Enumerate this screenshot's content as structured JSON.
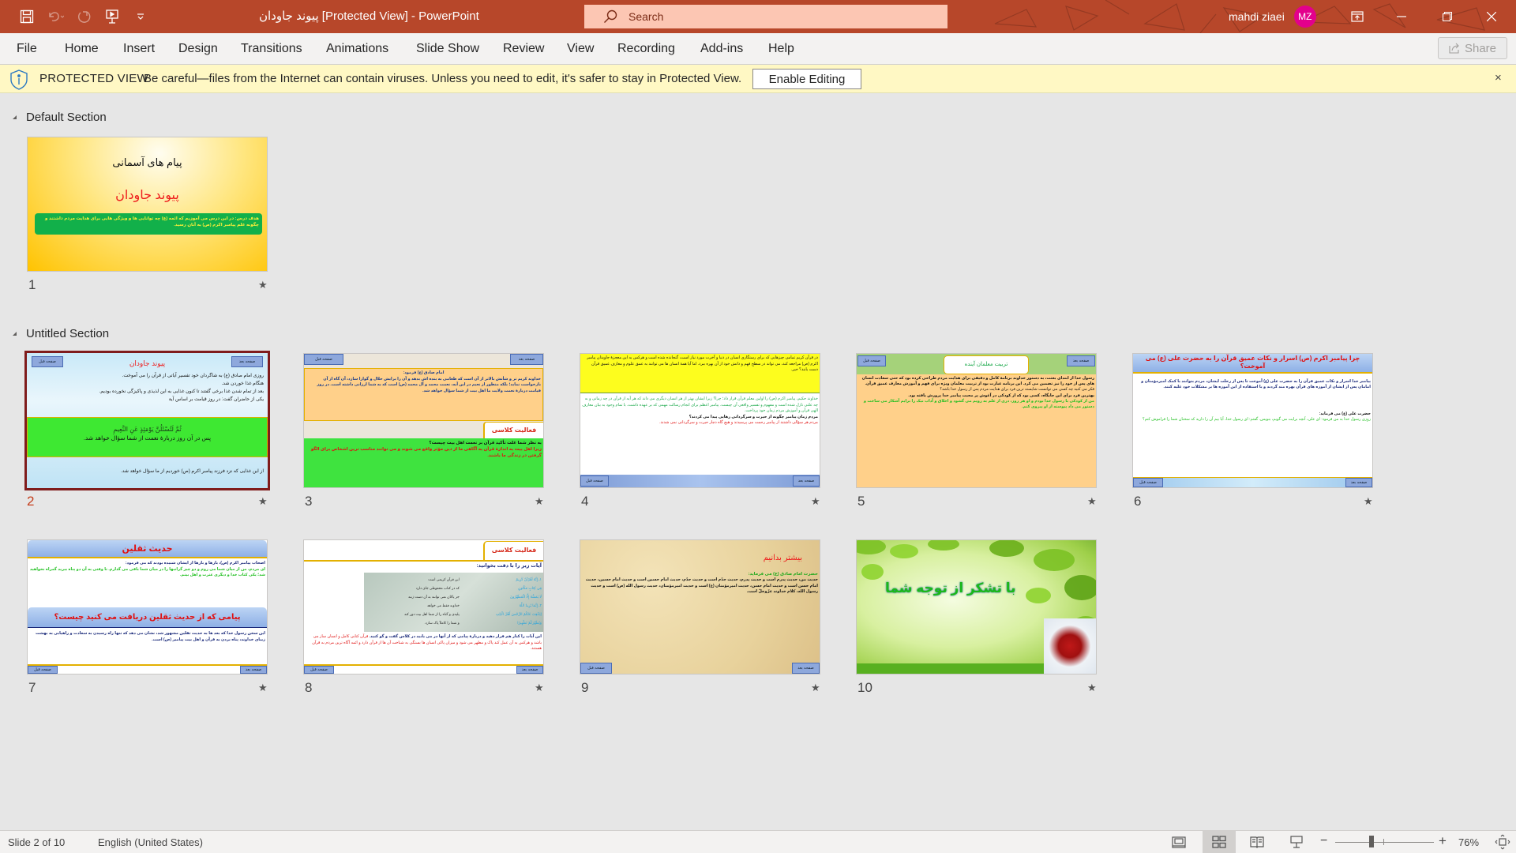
{
  "titlebar": {
    "doc_title": "پیوند جاودان [Protected View]  -  PowerPoint",
    "search_placeholder": "Search",
    "user_name": "mahdi ziaei",
    "user_initials": "MZ",
    "qat_icons": [
      "save-icon",
      "undo-icon",
      "redo-icon",
      "start-slideshow-icon",
      "customize-qat-icon"
    ],
    "window_controls": [
      "ribbon-display-options-icon",
      "minimize-icon",
      "restore-icon",
      "close-icon"
    ]
  },
  "ribbon": {
    "tabs": [
      "File",
      "Home",
      "Insert",
      "Design",
      "Transitions",
      "Animations",
      "Slide Show",
      "Review",
      "View",
      "Recording",
      "Add-ins",
      "Help"
    ],
    "share_label": "Share"
  },
  "protected_view": {
    "label": "PROTECTED VIEW",
    "message": "Be careful—files from the Internet can contain viruses. Unless you need to edit, it's safer to stay in Protected View.",
    "button": "Enable Editing",
    "close": "×"
  },
  "sections": [
    {
      "name": "Default Section"
    },
    {
      "name": "Untitled Section"
    }
  ],
  "slides": [
    {
      "number": "1",
      "title": "پیام های آسمانی",
      "subtitle": "پیوند جاودان",
      "box_text": "هدف درس: در این درس می آموزیم که ائمه (ع) چه توانایی ها و ویژگی هایی برای هدایت مردم داشتند و چگونه علم پیامبر اکرم (ص) به آنان رسید."
    },
    {
      "number": "2",
      "title": "پیوند جاودان",
      "prev": "صفحه قبل",
      "next": "صفحه بعد",
      "lines": [
        "روزی امام صادق (ع) به شاگردان خود تفسیر آیاتی از قرآن را می آموخت.",
        "هنگام غذا خوردن شد.",
        "بعد از تمام شدن غذا برخی گفتند تا کنون غذایی به این لذیذی و پاکیزگی نخورده بودیم.",
        "یکی از حاضران گفت: در روز قیامت بر اساس آیة"
      ],
      "verse": "ثُمَّ لَتُسْئَلُنَّ يَوْمَئِذٍ عَنِ النَّعِيمِ",
      "verse_tr": "پس در آن روز دربارهٔ نعمت از شما سؤال خواهد شد.",
      "footer": "از این غذایی که نزد فرزند پیامبر اکرم (ص) خوردیم از ما سؤال خواهد شد."
    },
    {
      "number": "3",
      "prev": "صفحه قبل",
      "next": "صفحه بعد",
      "quote_head": "امام صادق (ع) فرمود:",
      "quote": "خداوند کریم تر و شأنش بالاتر از آن است که طعامی به بنده اش بدهد و آن را برایش حلال و گوارا سازد، آن گاه از آن بازخواست نماید؛ بلکه منظور از نعیم در این آیه، نعمت محمد و آل محمد (ص) است که به شما ارزانی داشته است. در روز قیامت دربارهٔ نعمت ولایت ما اهل بیت از شما سؤال خواهد شد.",
      "activity": "فعالیت کلاسی",
      "question": "به نظر شما علت تأکید قرآن بر نعمت اهل بیت چیست؟",
      "answer": "زیرا اهل بیت به اندازهٔ قرآن به آگاهی ما از دین مؤثر واقع می شوند و می توانند مناسب ترین اشخاص برای الگو گرفتن در زندگی ما باشند."
    },
    {
      "number": "4",
      "prev": "صفحه قبل",
      "next": "صفحه بعد",
      "top": "در قرآن کریم تمامی چیزهایی که برای رستگاری انسان در دنیا و آخرت مورد نیاز است، گنجانده شده است و هرکس به این معجزهٔ جاویدان پیامبر اکرم (ص) مراجعه کند، می تواند در سطح فهم و دانش خود از آن بهره ببرد. اما آیا همهٔ انسان ها می توانند به عمق علوم و معارف عمیق قرآن دست یابند؟ خیر.",
      "body": "خداوند حکیم، پیامبر اکرم (ص) را اولین معلم قرآن قرار داد؛ چرا؟ زیرا ایشان بهتر از هر انسان دیگری می داند که هر آیه از قرآن در چه زمانی و به چه علتی نازل شده است و مفهوم و تفسیر واقعی آن چیست. پیامبر اعظم برای انجام رسالت مهمی که بر عهده داشت، با تمام وجود به بیان معارف الهی قرآن و آموزش مردم زمان خود پرداخت.",
      "q": "مردم زمان پیامبر چگونه از حیرت و سرگردانی رهایی پیدا می کردند؟",
      "a": "مردم هر سؤالی داشتند از پیامبر رحمت می پرسیدند و هیچ گاه دچار حیرت و سرگردانی نمی شدند."
    },
    {
      "number": "5",
      "prev": "صفحه قبل",
      "next": "صفحه بعد",
      "title": "تربیت معلمان آینده",
      "body": "رسول خدا از ابتدای بعثت، به دستور خداوند برنامهٔ کامل و دقیقی برای هدایت مردم طراحی کرده بود که حتی سعادت انسان های پس از خود را نیز تضمین می کرد. این برنامه عبارت بود از تربیت معلمان ویژه برای فهم و آموزش معارف عمیق قرآن.",
      "q": "فکر می کنید چه کسی می توانست شایسته ترین فرد برای هدایت مردم پس از رسول خدا باشد؟",
      "a": "بهترین فرد برای این جایگاه، کسی بود که از کودکی در آغوش پر محبت پیامبر خدا پرورش یافته بود.",
      "quote": "من از کودکی با رسول خدا بودم و او هر روز، دری از علم به رویم می گشود و اخلاق و آداب نیک را برایم آشکار می ساخت و دستور می داد پیوسته از او پیروی کنم."
    },
    {
      "number": "6",
      "prev": "صفحه قبل",
      "next": "صفحه بعد",
      "title": "چرا پیامبر اکرم (ص) اسرار و نکات عمیق قرآن را به حضرت علی (ع) می آموخت؟",
      "body": "پیامبر خدا اسرار و نکات عمیق قرآن را به حضرت علی (ع) آموخت تا پس از رحلت ایشان، مردم بتوانند با کمک امیرمؤمنان و امامان پس از ایشان از آموزه های قرآن بهره مند گردند و با استفاده از این آموزه ها بر مشکلات خود غلبه کنند.",
      "head": "حضرت علی (ع) می فرماید:",
      "quote": "روزی رسول خدا به من فرمود: ای علی، آنچه برایت می گویم، بنویس. گفتم: ای رسول خدا، آیا بیم آن را دارید که سخنان شما را فراموش کنم؟"
    },
    {
      "number": "7",
      "prev": "صفحه قبل",
      "next": "صفحه بعد",
      "title": "حدیث ثقلین",
      "intro": "اصحاب پیامبر اکرم (ص)، بارها و بارها از ایشان شنیده بودند که می فرمود:",
      "quote": "ای مردم، من از میان شما می روم و دو چیز گرانبها را در میان شما باقی می گذارم. تا وقتی به آن دو پناه ببرید گمراه نخواهید شد؛ یکی کتاب خدا و دیگری عترت و اهل بیتم.",
      "q_title": "پیامی که از حدیث ثقلین دریافت می کنید چیست؟",
      "answer": "این سخن رسول خدا که بعد ها به حدیث ثقلین مشهور شد، نشان می دهد که تنها راه رسیدن به سعادت و راهیابی به بهشت زیبای خداوند، پناه بردن به قرآن و اهل بیت پیامبر (ص) است."
    },
    {
      "number": "8",
      "prev": "صفحه قبل",
      "next": "صفحه بعد",
      "activity": "فعالیت کلاسی",
      "head": "آیات زیر را با دقت بخوانید:",
      "verses": [
        "۱ـ إِنَّهُ لَقُرْآنٌ كَرِيمٌ",
        "فِي كِتَابٍ مَكْنُونٍ",
        "لَا يَمَسُّهُ إِلَّا الْمُطَهَّرُونَ",
        "۲ـ إِنَّمَا يُرِيدُ اللَّهُ",
        "لِيُذْهِبَ عَنْكُمُ الرِّجْسَ أَهْلَ الْبَيْتِ",
        "وَيُطَهِّرَكُمْ تَطْهِيرًا"
      ],
      "translation": [
        "این قرآن کریمی است",
        "که در کتاب محفوظی جای دارد",
        "جز پاکان نمی توانند به آن دست زنند",
        "خداوند فقط می خواهد",
        "پلیدی و گناه را از شما اهل بیت دور کند",
        "و شما را کاملاً پاک سازد."
      ],
      "question": "این آیات را کنار هم قرار دهید و دربارهٔ پیامی که از آنها در می یابید در کلاس گفت و گو کنید.",
      "answer": "قرآن کتابی کامل و انسان ساز می باشد و هرکس به آن عمل کند پاک و مطهر می شود و میزان پاکی انسان ها بستگی به شناخت آن ها از قرآن دارد و ائمه آگاه ترین مردم به قرآن هستند."
    },
    {
      "number": "9",
      "prev": "صفحه قبل",
      "next": "صفحه بعد",
      "title": "بیشتر بدانیم",
      "head": "حضرت امام صادق (ع) می فرماید:",
      "body": "حدیث من، حدیث پدرم است و حدیث پدرم، حدیث جدّم است و حدیث جدّم، حدیث امام حسین است و حدیث امام حسین، حدیث امام حسن است و حدیث امام حسن، حدیث امیرمؤمنان (ع) است و حدیث امیرمؤمنان، حدیث رسول الله (ص) است و حدیث رسول الله، کلام خداوند عزّوجلّ است."
    },
    {
      "number": "10",
      "title": "با تشکر از توجه شما"
    }
  ],
  "status": {
    "slide_indicator": "Slide 2 of 10",
    "language": "English (United States)",
    "views": [
      "normal-view",
      "slide-sorter-view",
      "reading-view",
      "slideshow-view"
    ],
    "active_view": "slide-sorter-view",
    "zoom_label": "76%",
    "zoom_percent": 76
  }
}
